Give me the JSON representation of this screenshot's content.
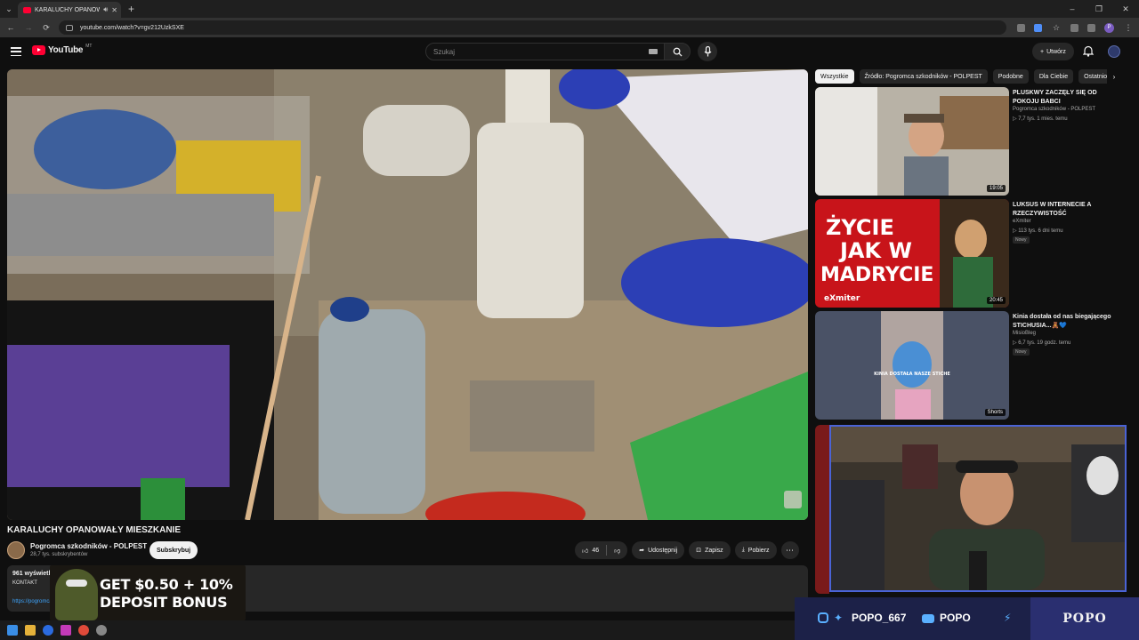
{
  "browser": {
    "tab_title": "KARALUCHY OPANOWAŁY",
    "url": "youtube.com/watch?v=gv212UzkSXE"
  },
  "masthead": {
    "logo_text": "YouTube",
    "region": "MT",
    "search_placeholder": "Szukaj",
    "create_label": "Utwórz"
  },
  "video": {
    "title": "KARALUCHY OPANOWAŁY MIESZKANIE",
    "channel": "Pogromca szkodników - POLPEST",
    "subscribers": "28,7 tys. subskrybentów",
    "subscribe_label": "Subskrybuj",
    "likes": "46",
    "share_label": "Udostępnij",
    "save_label": "Zapisz",
    "download_label": "Pobierz",
    "description": {
      "views": "961 wyświetleń",
      "line": "KONTAKT",
      "link": "https://pogromca"
    }
  },
  "overlay_ad": {
    "line1": "GET $0.50 + 10%",
    "line2": "DEPOSIT BONUS"
  },
  "chips": [
    "Wszystkie",
    "Źródło: Pogromca szkodników - POLPEST",
    "Podobne",
    "Dla Ciebie",
    "Ostatnio"
  ],
  "recommendations": [
    {
      "title": "PLUSKWY ZACZĘŁY SIĘ OD POKOJU BABCI",
      "channel": "Pogromca szkodników - POLPEST",
      "meta": "▷ 7,7 tys.   1 mies. temu",
      "duration": "19:05",
      "badge": ""
    },
    {
      "title": "LUKSUS W INTERNECIE A RZECZYWISTOŚĆ",
      "channel": "eXmiter",
      "meta": "▷ 113 tys.   6 dni temu",
      "duration": "20:45",
      "badge": "Nowy",
      "thumb_text1": "ŻYCIE",
      "thumb_text2": "JAK W",
      "thumb_text3": "MADRYCIE",
      "thumb_brand": "eXmiter"
    },
    {
      "title": "Kinia dostała od nas biegającego STICHUSIA...🧸💙",
      "channel": "MisioBleg",
      "meta": "▷ 6,7 tys.   19 godz. temu",
      "duration": "Shorts",
      "badge": "Nowy",
      "thumb_caption": "KINIA DOSTAŁA NASZE STICHE"
    }
  ],
  "stream_bar": {
    "handle1": "POPO_667",
    "handle2": "POPO",
    "brand": "POPO"
  },
  "colors": {
    "youtube_red": "#ff0033",
    "accent_blue": "#4a63d6",
    "link_blue": "#3ea6ff"
  }
}
